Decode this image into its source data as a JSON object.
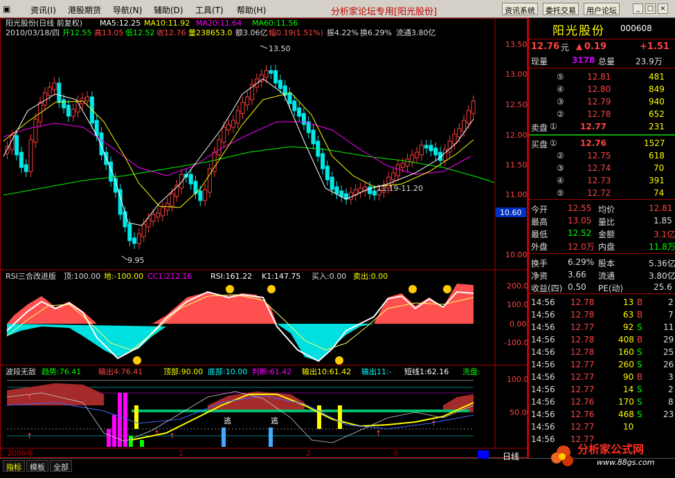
{
  "menu": {
    "items": [
      "资讯(I)",
      "港股期货",
      "导航(N)",
      "辅助(D)",
      "工具(T)",
      "帮助(H)"
    ],
    "brand": "分析家论坛专用",
    "brand_stock": "[阳光股份]",
    "buttons": [
      "资讯系统",
      "委托交易",
      "用户论坛"
    ],
    "window_buttons": [
      "_",
      "□",
      "×"
    ]
  },
  "main_chart": {
    "title": "阳光股份(日线 前复权)",
    "ma5": "MA5:12.25",
    "ma10": "MA10:11.92",
    "ma20": "MA20:11.64",
    "ma60": "MA60:11.56",
    "date": "2010/03/18/四",
    "open": "开12.55",
    "high": "高13.05",
    "low": "低12.52",
    "close": "收12.76",
    "vol": "量238653.0",
    "amount": "额3.06亿",
    "change_pct": "幅0.19(1.51%)",
    "amplitude": "振4.22%",
    "turnover": "换6.29%",
    "float": "流通3.80亿",
    "high_label": "13.50",
    "low_label": "9.95",
    "range_label": "11.19-11.20",
    "price_axis": [
      "13.50",
      "13.00",
      "12.50",
      "12.00",
      "11.50",
      "11.00",
      "10.60",
      "10.00"
    ],
    "colors": {
      "up": "#ff3c3c",
      "down": "#00ffff",
      "ma5": "#ffffff",
      "ma10": "#ffff00",
      "ma20": "#ff00ff",
      "ma60": "#00ff00"
    }
  },
  "rsi_panel": {
    "title": "RSI三合改进版",
    "top": "顶:100.00",
    "bottom": "地:-100.00",
    "cc1": "CC1:212.16",
    "rsi": "RSI:161.22",
    "k1": "K1:147.75",
    "buy": "买入:0.00",
    "sell": "卖出:0.00",
    "axis": [
      "200.00",
      "100.00",
      "0.00",
      "-100.00"
    ]
  },
  "wave_panel": {
    "title": "波段无敌",
    "trend": "趋势:76.41",
    "out1": "输出4:76.41",
    "top": "顶部:90.00",
    "bottom": "底部:10.00",
    "judge": "判断:61.42",
    "out10": "输出10:61.42",
    "out11": "输出11:-",
    "short": "短线1:62.16",
    "wash": "洗盘:",
    "axis": [
      "100.00",
      "50.00"
    ],
    "escape": "逃"
  },
  "date_axis": {
    "year": "2009年",
    "m1": "1",
    "m2": "2",
    "m3": "3"
  },
  "right_panel": {
    "name": "阳光股份",
    "code": "000608",
    "price": "12.76",
    "price_unit": "元",
    "change_arrow": "▲",
    "change": "0.19",
    "change_abs": "+1.51",
    "now_vol_label": "现量",
    "now_vol": "3178",
    "total_vol_label": "总量",
    "total_vol": "23.9万",
    "sell_label": "卖盘",
    "buy_label": "买盘",
    "asks": [
      {
        "level": "⑤",
        "price": "12.81",
        "vol": "481"
      },
      {
        "level": "④",
        "price": "12.80",
        "vol": "849"
      },
      {
        "level": "③",
        "price": "12.79",
        "vol": "940"
      },
      {
        "level": "②",
        "price": "12.78",
        "vol": "652"
      },
      {
        "level": "①",
        "price": "12.77",
        "vol": "231"
      }
    ],
    "bids": [
      {
        "level": "①",
        "price": "12.76",
        "vol": "1527"
      },
      {
        "level": "②",
        "price": "12.75",
        "vol": "618"
      },
      {
        "level": "③",
        "price": "12.74",
        "vol": "70"
      },
      {
        "level": "④",
        "price": "12.73",
        "vol": "391"
      },
      {
        "level": "⑤",
        "price": "12.72",
        "vol": "74"
      }
    ],
    "stats": [
      {
        "l1": "今开",
        "v1": "12.55",
        "l2": "均价",
        "v2": "12.81"
      },
      {
        "l1": "最高",
        "v1": "13.05",
        "l2": "量比",
        "v2": "1.85"
      },
      {
        "l1": "最低",
        "v1": "12.52",
        "l2": "金额",
        "v2": "3.1亿"
      },
      {
        "l1": "外盘",
        "v1": "12.0万",
        "l2": "内盘",
        "v2": "11.8万"
      }
    ],
    "stats2": [
      {
        "l1": "换手",
        "v1": "6.29%",
        "l2": "股本",
        "v2": "5.36亿"
      },
      {
        "l1": "净资",
        "v1": "3.66",
        "l2": "流通",
        "v2": "3.80亿"
      },
      {
        "l1": "收益(四)",
        "v1": "0.50",
        "l2": "PE(动)",
        "v2": "25.6"
      }
    ],
    "ticks": [
      {
        "t": "14:56",
        "p": "12.78",
        "v": "13",
        "d": "B",
        "n": "2"
      },
      {
        "t": "14:56",
        "p": "12.78",
        "v": "63",
        "d": "B",
        "n": "7"
      },
      {
        "t": "14:56",
        "p": "12.77",
        "v": "92",
        "d": "S",
        "n": "11"
      },
      {
        "t": "14:56",
        "p": "12.78",
        "v": "408",
        "d": "B",
        "n": "29"
      },
      {
        "t": "14:56",
        "p": "12.78",
        "v": "160",
        "d": "S",
        "n": "25"
      },
      {
        "t": "14:56",
        "p": "12.77",
        "v": "260",
        "d": "S",
        "n": "26"
      },
      {
        "t": "14:56",
        "p": "12.77",
        "v": "90",
        "d": "B",
        "n": "3"
      },
      {
        "t": "14:56",
        "p": "12.77",
        "v": "14",
        "d": "S",
        "n": "2"
      },
      {
        "t": "14:56",
        "p": "12.76",
        "v": "170",
        "d": "S",
        "n": "8"
      },
      {
        "t": "14:56",
        "p": "12.76",
        "v": "468",
        "d": "S",
        "n": "23"
      },
      {
        "t": "14:56",
        "p": "12.77",
        "v": "10",
        "d": "",
        "n": ""
      },
      {
        "t": "14:56",
        "p": "12.77",
        "v": "",
        "d": "",
        "n": ""
      }
    ]
  },
  "bottom": {
    "tabs": [
      "指标",
      "模板",
      "全部"
    ],
    "period": "日线",
    "logo_text": "分析家公式网",
    "logo_url": "www.88gs.com"
  }
}
